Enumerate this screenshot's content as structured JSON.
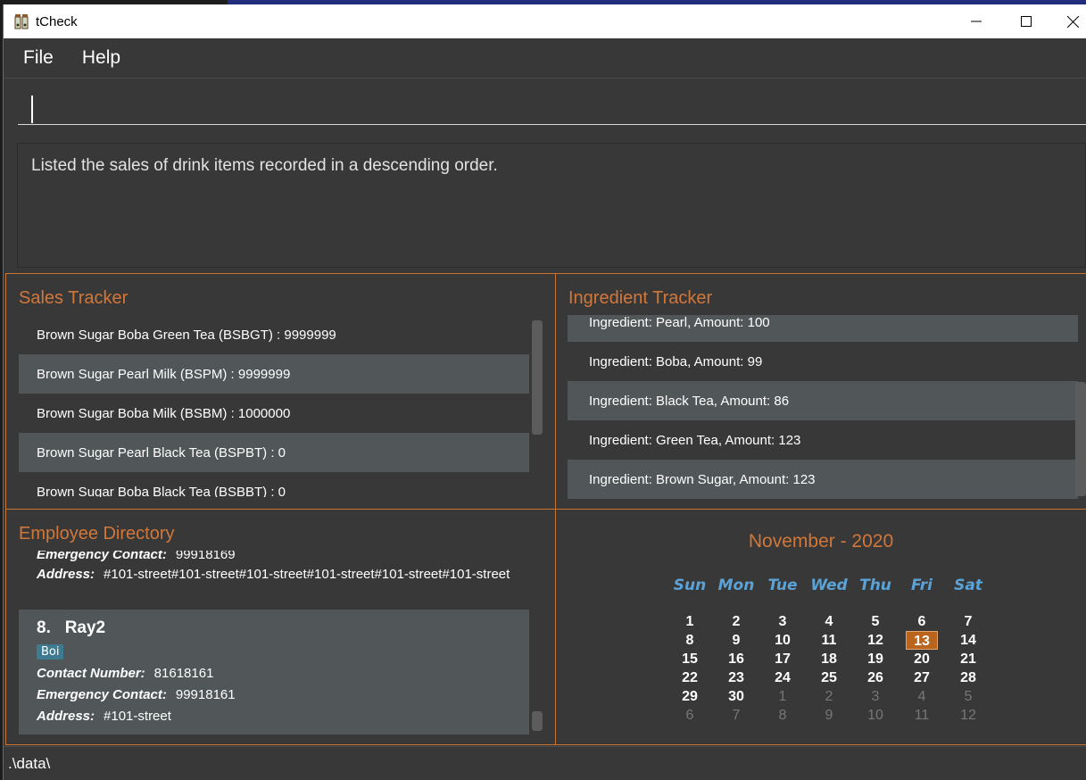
{
  "window": {
    "title": "tCheck"
  },
  "menubar": {
    "items": [
      "File",
      "Help"
    ]
  },
  "command": {
    "value": "",
    "placeholder": ""
  },
  "result": {
    "text": "Listed the sales of drink items recorded in a descending order."
  },
  "sales": {
    "title": "Sales Tracker",
    "items": [
      "Brown Sugar Boba Green Tea (BSBGT) : 9999999",
      "Brown Sugar Pearl Milk (BSPM) : 9999999",
      "Brown Sugar Boba Milk (BSBM) : 1000000",
      "Brown Sugar Pearl Black Tea (BSPBT) : 0",
      "Brown Sugar Boba Black Tea (BSBBT) : 0"
    ]
  },
  "ingredients": {
    "title": "Ingredient Tracker",
    "items": [
      "Ingredient: Pearl,  Amount: 100",
      "Ingredient: Boba,  Amount: 99",
      "Ingredient: Black Tea,  Amount: 86",
      "Ingredient: Green Tea,  Amount: 123",
      "Ingredient: Brown Sugar,  Amount: 123"
    ]
  },
  "employees": {
    "title": "Employee Directory",
    "labels": {
      "contact": "Contact Number:",
      "emergency": "Emergency Contact:",
      "address": "Address:"
    },
    "partial": {
      "emergency": "99918169",
      "address": "#101-street#101-street#101-street#101-street#101-street#101-street"
    },
    "card": {
      "index": "8.",
      "name": "Ray2",
      "tag": "Boi",
      "contact": "81618161",
      "emergency": "99918161",
      "address": "#101-street"
    }
  },
  "calendar": {
    "title": "November - 2020",
    "days": [
      "Sun",
      "Mon",
      "Tue",
      "Wed",
      "Thu",
      "Fri",
      "Sat"
    ],
    "weeks": [
      [
        "1",
        "2",
        "3",
        "4",
        "5",
        "6",
        "7"
      ],
      [
        "8",
        "9",
        "10",
        "11",
        "12",
        "13",
        "14"
      ],
      [
        "15",
        "16",
        "17",
        "18",
        "19",
        "20",
        "21"
      ],
      [
        "22",
        "23",
        "24",
        "25",
        "26",
        "27",
        "28"
      ],
      [
        "29",
        "30",
        "1",
        "2",
        "3",
        "4",
        "5"
      ],
      [
        "6",
        "7",
        "8",
        "9",
        "10",
        "11",
        "12"
      ]
    ],
    "today": "13"
  },
  "status": {
    "path": ".\\data\\"
  },
  "colors": {
    "accent": "#d2773a",
    "day_header": "#5ba3d6",
    "today_bg": "#b9651d",
    "tag_bg": "#3e7b91"
  }
}
